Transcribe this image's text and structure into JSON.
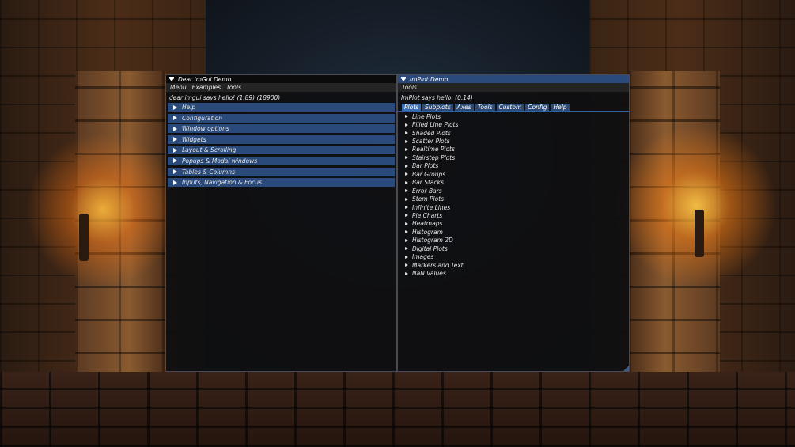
{
  "imgui_window": {
    "title": "Dear ImGui Demo",
    "menu": [
      "Menu",
      "Examples",
      "Tools"
    ],
    "hello_text": "dear imgui says hello! (1.89) (18900)",
    "headers": [
      "Help",
      "Configuration",
      "Window options",
      "Widgets",
      "Layout & Scrolling",
      "Popups & Modal windows",
      "Tables & Columns",
      "Inputs, Navigation & Focus"
    ]
  },
  "implot_window": {
    "title": "ImPlot Demo",
    "menu": [
      "Tools"
    ],
    "hello_text": "ImPlot says hello. (0.14)",
    "tabs": [
      "Plots",
      "Subplots",
      "Axes",
      "Tools",
      "Custom",
      "Config",
      "Help"
    ],
    "active_tab": "Plots",
    "tree_items": [
      "Line Plots",
      "Filled Line Plots",
      "Shaded Plots",
      "Scatter Plots",
      "Realtime Plots",
      "Stairstep Plots",
      "Bar Plots",
      "Bar Groups",
      "Bar Stacks",
      "Error Bars",
      "Stem Plots",
      "Infinite Lines",
      "Pie Charts",
      "Heatmaps",
      "Histogram",
      "Histogram 2D",
      "Digital Plots",
      "Images",
      "Markers and Text",
      "NaN Values"
    ]
  },
  "colors": {
    "header": "#294a7a",
    "tab_active": "#3b6fb5",
    "title_active": "#294a7a",
    "window_bg": "#0f0f11"
  }
}
